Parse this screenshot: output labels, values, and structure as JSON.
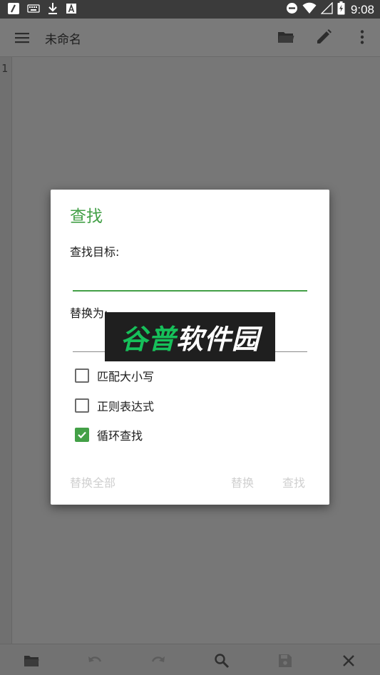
{
  "status_bar": {
    "time": "9:08",
    "icons_left": [
      "app-icon",
      "keyboard-icon",
      "download-icon",
      "a-icon"
    ],
    "icons_right": [
      "do-not-disturb-icon",
      "wifi-icon",
      "signal-icon",
      "battery-icon"
    ]
  },
  "app_bar": {
    "title": "未命名",
    "actions": [
      "open-folder-icon",
      "edit-icon",
      "more-vert-icon"
    ]
  },
  "editor": {
    "line_number": "1"
  },
  "dialog": {
    "title": "查找",
    "find_label": "查找目标:",
    "find_value": "",
    "replace_label": "替换为:",
    "replace_value": "",
    "options": [
      {
        "label": "匹配大小写",
        "checked": false
      },
      {
        "label": "正则表达式",
        "checked": false
      },
      {
        "label": "循环查找",
        "checked": true
      }
    ],
    "buttons": {
      "replace_all": "替换全部",
      "replace": "替换",
      "find": "查找"
    }
  },
  "watermark": {
    "text_part1": "谷普",
    "text_part2": "软件园"
  },
  "bottom_bar": {
    "actions": [
      "folder-icon",
      "undo-icon",
      "redo-icon",
      "search-icon",
      "save-icon",
      "close-icon"
    ]
  },
  "colors": {
    "accent": "#43a047",
    "scrim_bg": "#777777",
    "disabled_text": "#cfcfcf"
  }
}
